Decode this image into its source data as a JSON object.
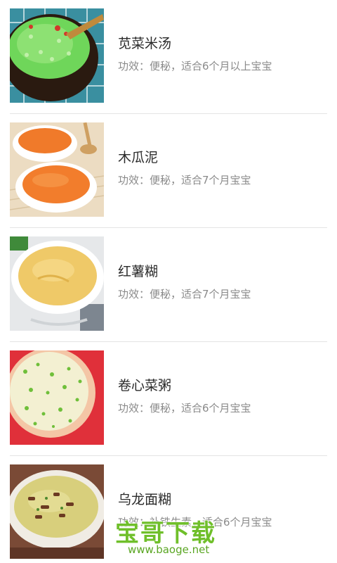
{
  "recipes": [
    {
      "name": "苋菜米汤",
      "effect": "功效：便秘，适合6个月以上宝宝",
      "image": "amaranth-rice-soup-photo"
    },
    {
      "name": "木瓜泥",
      "effect": "功效：便秘，适合7个月宝宝",
      "image": "papaya-puree-photo"
    },
    {
      "name": "红薯糊",
      "effect": "功效：便秘，适合7个月宝宝",
      "image": "sweet-potato-paste-photo"
    },
    {
      "name": "卷心菜粥",
      "effect": "功效：便秘，适合6个月宝宝",
      "image": "cabbage-porridge-photo"
    },
    {
      "name": "乌龙面糊",
      "effect": "功效：补铁生素，适合6个月宝宝",
      "image": "oolong-noodle-paste-photo"
    }
  ],
  "watermark": {
    "brand": "宝哥下载",
    "url": "www.baoge.net"
  },
  "colors": {
    "title": "#2b2b2b",
    "subtitle": "#8a8a8a",
    "divider": "#e4e4e4",
    "watermark": "#6fbf2a"
  }
}
